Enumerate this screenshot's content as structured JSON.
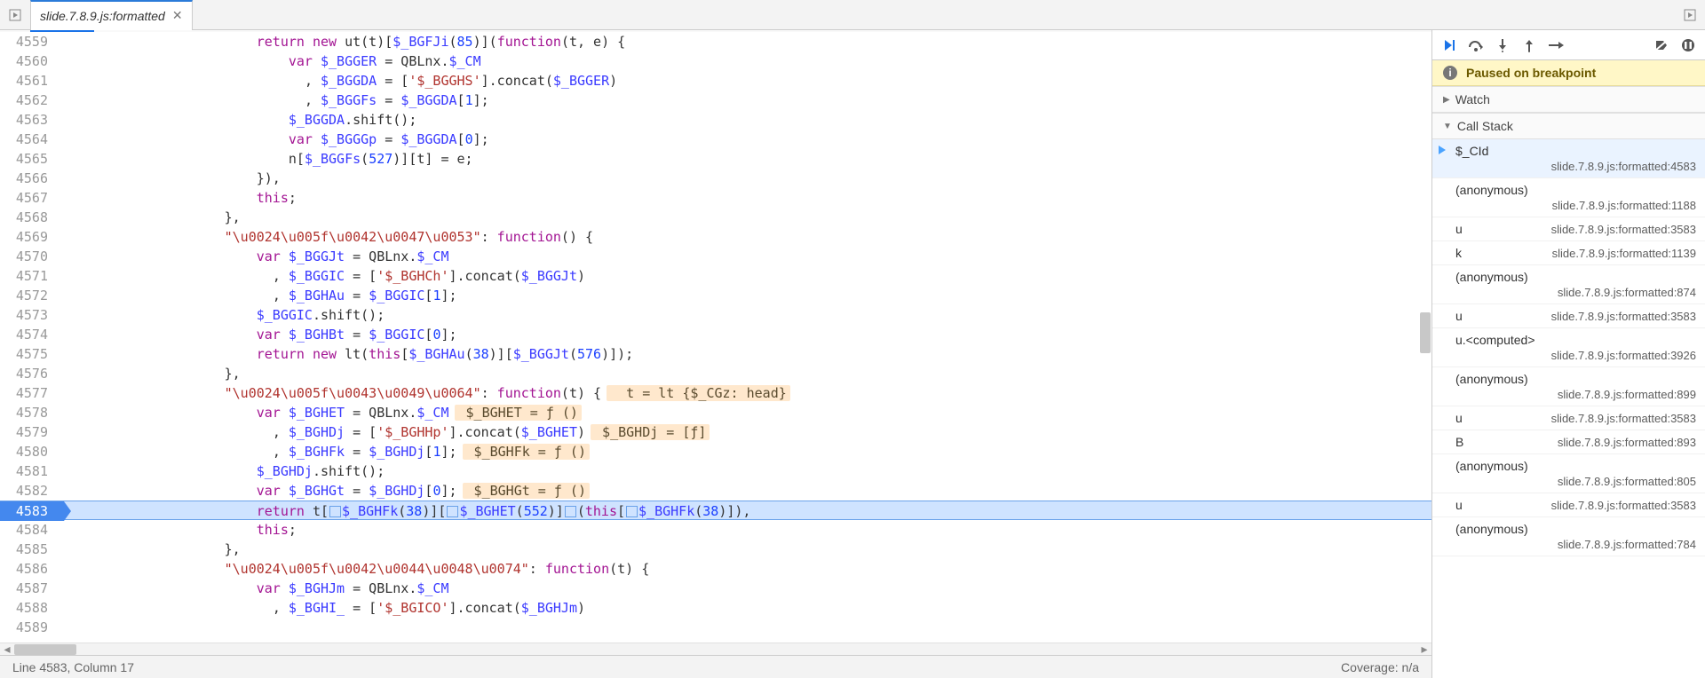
{
  "tab": {
    "title": "slide.7.8.9.js:formatted"
  },
  "status": {
    "left": "Line 4583, Column 17",
    "right": "Coverage: n/a"
  },
  "code": {
    "first_line": 4559,
    "exec_line": 4583,
    "lines": [
      {
        "indent": 24,
        "tokens": [
          {
            "t": "return",
            "c": "kw"
          },
          {
            "t": " "
          },
          {
            "t": "new",
            "c": "kw"
          },
          {
            "t": " ut(t)["
          },
          {
            "t": "$_BGFJi",
            "c": "fn"
          },
          {
            "t": "("
          },
          {
            "t": "85",
            "c": "num"
          },
          {
            "t": ")]("
          },
          {
            "t": "function",
            "c": "kw"
          },
          {
            "t": "(t, e) {"
          }
        ]
      },
      {
        "indent": 28,
        "tokens": [
          {
            "t": "var",
            "c": "kw"
          },
          {
            "t": " "
          },
          {
            "t": "$_BGGER",
            "c": "fn"
          },
          {
            "t": " = QBLnx."
          },
          {
            "t": "$_CM",
            "c": "fn"
          }
        ]
      },
      {
        "indent": 30,
        "tokens": [
          {
            "t": ", "
          },
          {
            "t": "$_BGGDA",
            "c": "fn"
          },
          {
            "t": " = ["
          },
          {
            "t": "'$_BGGHS'",
            "c": "str"
          },
          {
            "t": "].concat("
          },
          {
            "t": "$_BGGER",
            "c": "fn"
          },
          {
            "t": ")"
          }
        ]
      },
      {
        "indent": 30,
        "tokens": [
          {
            "t": ", "
          },
          {
            "t": "$_BGGFs",
            "c": "fn"
          },
          {
            "t": " = "
          },
          {
            "t": "$_BGGDA",
            "c": "fn"
          },
          {
            "t": "["
          },
          {
            "t": "1",
            "c": "num"
          },
          {
            "t": "];"
          }
        ]
      },
      {
        "indent": 28,
        "tokens": [
          {
            "t": "$_BGGDA",
            "c": "fn"
          },
          {
            "t": ".shift();"
          }
        ]
      },
      {
        "indent": 28,
        "tokens": [
          {
            "t": "var",
            "c": "kw"
          },
          {
            "t": " "
          },
          {
            "t": "$_BGGGp",
            "c": "fn"
          },
          {
            "t": " = "
          },
          {
            "t": "$_BGGDA",
            "c": "fn"
          },
          {
            "t": "["
          },
          {
            "t": "0",
            "c": "num"
          },
          {
            "t": "];"
          }
        ]
      },
      {
        "indent": 28,
        "tokens": [
          {
            "t": "n["
          },
          {
            "t": "$_BGGFs",
            "c": "fn"
          },
          {
            "t": "("
          },
          {
            "t": "527",
            "c": "num"
          },
          {
            "t": ")][t] = e;"
          }
        ]
      },
      {
        "indent": 24,
        "tokens": [
          {
            "t": "}),"
          }
        ]
      },
      {
        "indent": 24,
        "tokens": [
          {
            "t": "this",
            "c": "kw"
          },
          {
            "t": ";"
          }
        ]
      },
      {
        "indent": 20,
        "tokens": [
          {
            "t": "},"
          }
        ]
      },
      {
        "indent": 20,
        "tokens": [
          {
            "t": "\"\\u0024\\u005f\\u0042\\u0047\\u0053\"",
            "c": "str"
          },
          {
            "t": ": "
          },
          {
            "t": "function",
            "c": "kw"
          },
          {
            "t": "() {"
          }
        ]
      },
      {
        "indent": 24,
        "tokens": [
          {
            "t": "var",
            "c": "kw"
          },
          {
            "t": " "
          },
          {
            "t": "$_BGGJt",
            "c": "fn"
          },
          {
            "t": " = QBLnx."
          },
          {
            "t": "$_CM",
            "c": "fn"
          }
        ]
      },
      {
        "indent": 26,
        "tokens": [
          {
            "t": ", "
          },
          {
            "t": "$_BGGIC",
            "c": "fn"
          },
          {
            "t": " = ["
          },
          {
            "t": "'$_BGHCh'",
            "c": "str"
          },
          {
            "t": "].concat("
          },
          {
            "t": "$_BGGJt",
            "c": "fn"
          },
          {
            "t": ")"
          }
        ]
      },
      {
        "indent": 26,
        "tokens": [
          {
            "t": ", "
          },
          {
            "t": "$_BGHAu",
            "c": "fn"
          },
          {
            "t": " = "
          },
          {
            "t": "$_BGGIC",
            "c": "fn"
          },
          {
            "t": "["
          },
          {
            "t": "1",
            "c": "num"
          },
          {
            "t": "];"
          }
        ]
      },
      {
        "indent": 24,
        "tokens": [
          {
            "t": "$_BGGIC",
            "c": "fn"
          },
          {
            "t": ".shift();"
          }
        ]
      },
      {
        "indent": 24,
        "tokens": [
          {
            "t": "var",
            "c": "kw"
          },
          {
            "t": " "
          },
          {
            "t": "$_BGHBt",
            "c": "fn"
          },
          {
            "t": " = "
          },
          {
            "t": "$_BGGIC",
            "c": "fn"
          },
          {
            "t": "["
          },
          {
            "t": "0",
            "c": "num"
          },
          {
            "t": "];"
          }
        ]
      },
      {
        "indent": 24,
        "tokens": [
          {
            "t": "return",
            "c": "kw"
          },
          {
            "t": " "
          },
          {
            "t": "new",
            "c": "kw"
          },
          {
            "t": " lt("
          },
          {
            "t": "this",
            "c": "kw"
          },
          {
            "t": "["
          },
          {
            "t": "$_BGHAu",
            "c": "fn"
          },
          {
            "t": "("
          },
          {
            "t": "38",
            "c": "num"
          },
          {
            "t": ")]["
          },
          {
            "t": "$_BGGJt",
            "c": "fn"
          },
          {
            "t": "("
          },
          {
            "t": "576",
            "c": "num"
          },
          {
            "t": ")]);"
          }
        ]
      },
      {
        "indent": 20,
        "tokens": [
          {
            "t": "},"
          }
        ]
      },
      {
        "indent": 20,
        "tokens": [
          {
            "t": "\"\\u0024\\u005f\\u0043\\u0049\\u0064\"",
            "c": "str"
          },
          {
            "t": ": "
          },
          {
            "t": "function",
            "c": "kw"
          },
          {
            "t": "(t) {"
          }
        ],
        "eval": "  t = lt {$_CGz: head}"
      },
      {
        "indent": 24,
        "tokens": [
          {
            "t": "var",
            "c": "kw"
          },
          {
            "t": " "
          },
          {
            "t": "$_BGHET",
            "c": "fn"
          },
          {
            "t": " = QBLnx."
          },
          {
            "t": "$_CM",
            "c": "fn"
          }
        ],
        "eval": " $_BGHET = ƒ ()"
      },
      {
        "indent": 26,
        "tokens": [
          {
            "t": ", "
          },
          {
            "t": "$_BGHDj",
            "c": "fn"
          },
          {
            "t": " = ["
          },
          {
            "t": "'$_BGHHp'",
            "c": "str"
          },
          {
            "t": "].concat("
          },
          {
            "t": "$_BGHET",
            "c": "fn"
          },
          {
            "t": ")"
          }
        ],
        "eval": " $_BGHDj = [ƒ]"
      },
      {
        "indent": 26,
        "tokens": [
          {
            "t": ", "
          },
          {
            "t": "$_BGHFk",
            "c": "fn"
          },
          {
            "t": " = "
          },
          {
            "t": "$_BGHDj",
            "c": "fn"
          },
          {
            "t": "["
          },
          {
            "t": "1",
            "c": "num"
          },
          {
            "t": "];"
          }
        ],
        "eval": " $_BGHFk = ƒ ()"
      },
      {
        "indent": 24,
        "tokens": [
          {
            "t": "$_BGHDj",
            "c": "fn"
          },
          {
            "t": ".shift();"
          }
        ]
      },
      {
        "indent": 24,
        "tokens": [
          {
            "t": "var",
            "c": "kw"
          },
          {
            "t": " "
          },
          {
            "t": "$_BGHGt",
            "c": "fn"
          },
          {
            "t": " = "
          },
          {
            "t": "$_BGHDj",
            "c": "fn"
          },
          {
            "t": "["
          },
          {
            "t": "0",
            "c": "num"
          },
          {
            "t": "];"
          }
        ],
        "eval": " $_BGHGt = ƒ ()"
      },
      {
        "indent": 24,
        "exec": true,
        "tokens": [
          {
            "t": "return",
            "c": "kw"
          },
          {
            "t": " t["
          },
          {
            "step": true
          },
          {
            "t": "$_BGHFk",
            "c": "fn"
          },
          {
            "t": "("
          },
          {
            "t": "38",
            "c": "num"
          },
          {
            "t": ")]["
          },
          {
            "step": true
          },
          {
            "t": "$_BGHET",
            "c": "fn"
          },
          {
            "t": "("
          },
          {
            "t": "552",
            "c": "num"
          },
          {
            "t": ")]"
          },
          {
            "step": true
          },
          {
            "t": "("
          },
          {
            "t": "this",
            "c": "kw"
          },
          {
            "t": "["
          },
          {
            "step": true
          },
          {
            "t": "$_BGHFk",
            "c": "fn"
          },
          {
            "t": "("
          },
          {
            "t": "38",
            "c": "num"
          },
          {
            "t": ")]),"
          }
        ]
      },
      {
        "indent": 24,
        "tokens": [
          {
            "t": "this",
            "c": "kw"
          },
          {
            "t": ";"
          }
        ]
      },
      {
        "indent": 20,
        "tokens": [
          {
            "t": "},"
          }
        ]
      },
      {
        "indent": 20,
        "tokens": [
          {
            "t": "\"\\u0024\\u005f\\u0042\\u0044\\u0048\\u0074\"",
            "c": "str"
          },
          {
            "t": ": "
          },
          {
            "t": "function",
            "c": "kw"
          },
          {
            "t": "(t) {"
          }
        ]
      },
      {
        "indent": 24,
        "tokens": [
          {
            "t": "var",
            "c": "kw"
          },
          {
            "t": " "
          },
          {
            "t": "$_BGHJm",
            "c": "fn"
          },
          {
            "t": " = QBLnx."
          },
          {
            "t": "$_CM",
            "c": "fn"
          }
        ]
      },
      {
        "indent": 26,
        "tokens": [
          {
            "t": ", "
          },
          {
            "t": "$_BGHI_",
            "c": "fn"
          },
          {
            "t": " = ["
          },
          {
            "t": "'$_BGICO'",
            "c": "str"
          },
          {
            "t": "].concat("
          },
          {
            "t": "$_BGHJm",
            "c": "fn"
          },
          {
            "t": ")"
          }
        ]
      },
      {
        "indent": 0,
        "tokens": []
      }
    ]
  },
  "debugger": {
    "paused": "Paused on breakpoint",
    "sections": {
      "watch": "Watch",
      "callstack": "Call Stack"
    },
    "frames": [
      {
        "name": "$_CId",
        "loc": "slide.7.8.9.js:formatted:4583",
        "current": true
      },
      {
        "name": "(anonymous)",
        "loc": "slide.7.8.9.js:formatted:1188"
      },
      {
        "name": "u",
        "loc": "slide.7.8.9.js:formatted:3583",
        "short": true
      },
      {
        "name": "k",
        "loc": "slide.7.8.9.js:formatted:1139",
        "short": true
      },
      {
        "name": "(anonymous)",
        "loc": "slide.7.8.9.js:formatted:874"
      },
      {
        "name": "u",
        "loc": "slide.7.8.9.js:formatted:3583",
        "short": true
      },
      {
        "name": "u.<computed>",
        "loc": "slide.7.8.9.js:formatted:3926"
      },
      {
        "name": "(anonymous)",
        "loc": "slide.7.8.9.js:formatted:899"
      },
      {
        "name": "u",
        "loc": "slide.7.8.9.js:formatted:3583",
        "short": true
      },
      {
        "name": "B",
        "loc": "slide.7.8.9.js:formatted:893",
        "short": true
      },
      {
        "name": "(anonymous)",
        "loc": "slide.7.8.9.js:formatted:805"
      },
      {
        "name": "u",
        "loc": "slide.7.8.9.js:formatted:3583",
        "short": true
      },
      {
        "name": "(anonymous)",
        "loc": "slide.7.8.9.js:formatted:784"
      }
    ]
  }
}
